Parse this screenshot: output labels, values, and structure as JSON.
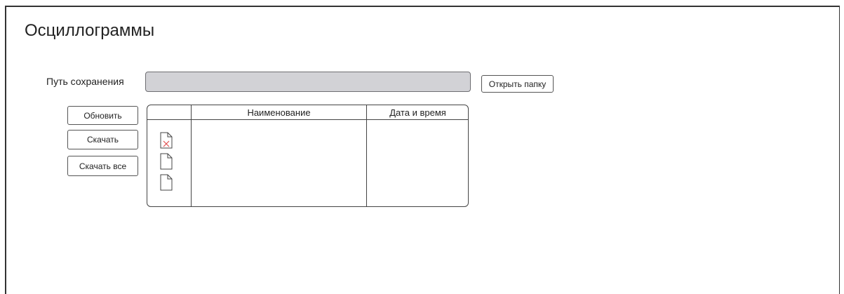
{
  "page": {
    "title": "Осциллограммы"
  },
  "save_path": {
    "label": "Путь сохранения",
    "value": "",
    "open_folder_button": "Открыть папку"
  },
  "actions": {
    "refresh": "Обновить",
    "download": "Скачать",
    "download_all": "Скачать все"
  },
  "table": {
    "columns": [
      "",
      "Наименование",
      "Дата и время"
    ],
    "rows": [
      {
        "icon": "file-error-icon",
        "name": "",
        "datetime": ""
      },
      {
        "icon": "file-icon",
        "name": "",
        "datetime": ""
      },
      {
        "icon": "file-icon",
        "name": "",
        "datetime": ""
      }
    ]
  },
  "colors": {
    "input_bg": "#d2d2d6",
    "error_mark": "#e05050",
    "border": "#444444"
  }
}
